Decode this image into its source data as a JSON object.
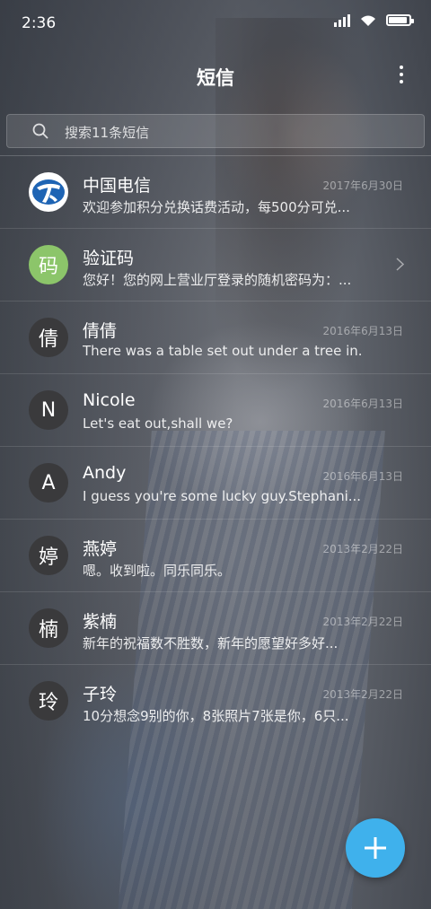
{
  "status_bar": {
    "time": "2:36",
    "battery_level": 0.9
  },
  "header": {
    "title": "短信"
  },
  "search": {
    "placeholder": "搜索11条短信"
  },
  "conversations": [
    {
      "avatar": "",
      "avatar_type": "china-telecom-logo",
      "name": "中国电信",
      "date": "2017年6月30日",
      "preview": "欢迎参加积分兑换话费活动，每500分可兑..."
    },
    {
      "avatar": "码",
      "avatar_type": "green",
      "name": "验证码",
      "date": "",
      "preview": "您好！您的网上营业厅登录的随机密码为：...",
      "has_chevron": true
    },
    {
      "avatar": "倩",
      "avatar_type": "dark",
      "name": "倩倩",
      "date": "2016年6月13日",
      "preview": "There was a table set out under a tree in..."
    },
    {
      "avatar": "N",
      "avatar_type": "dark",
      "name": "Nicole",
      "date": "2016年6月13日",
      "preview": "Let's eat out,shall we?"
    },
    {
      "avatar": "A",
      "avatar_type": "dark",
      "name": "Andy",
      "date": "2016年6月13日",
      "preview": "I guess you're some lucky guy.Stephani..."
    },
    {
      "avatar": "婷",
      "avatar_type": "dark",
      "name": "燕婷",
      "date": "2013年2月22日",
      "preview": "嗯。收到啦。同乐同乐。"
    },
    {
      "avatar": "楠",
      "avatar_type": "dark",
      "name": "紫楠",
      "date": "2013年2月22日",
      "preview": "新年的祝福数不胜数，新年的愿望好多好..."
    },
    {
      "avatar": "玲",
      "avatar_type": "dark",
      "name": "子玲",
      "date": "2013年2月22日",
      "preview": "10分想念9别的你，8张照片7张是你，6只..."
    }
  ],
  "fab": {
    "icon": "plus-icon",
    "color": "#3fb1ec"
  }
}
